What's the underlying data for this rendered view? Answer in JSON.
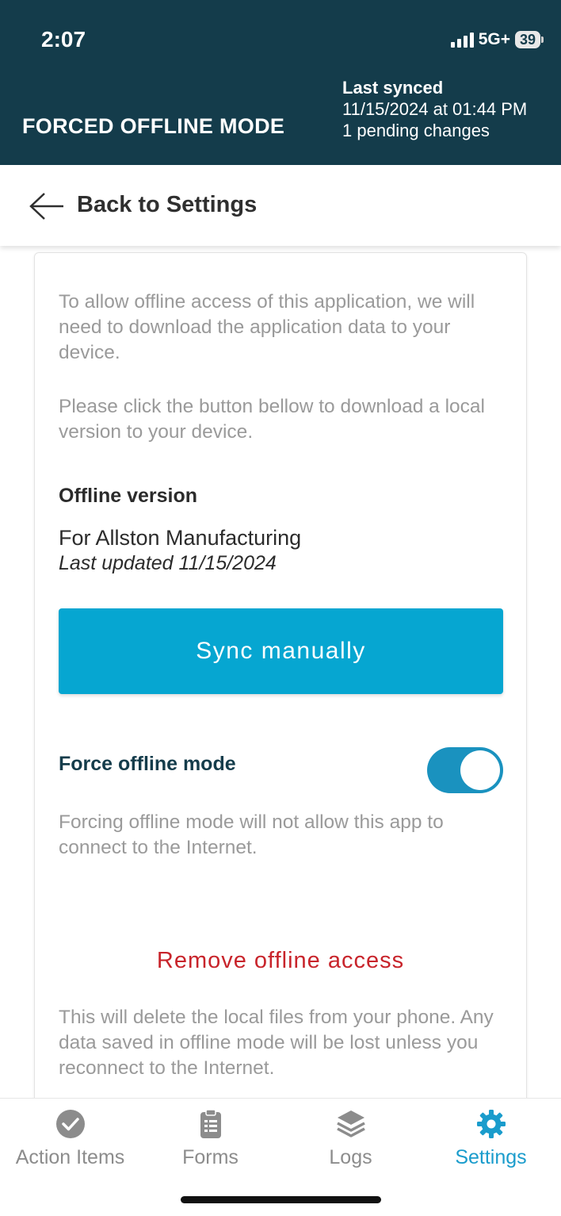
{
  "status_bar": {
    "time": "2:07",
    "network": "5G+",
    "battery": "39"
  },
  "header": {
    "title": "FORCED OFFLINE MODE",
    "last_synced_label": "Last synced",
    "last_synced_value": "11/15/2024 at 01:44 PM",
    "pending": "1 pending changes"
  },
  "back": {
    "label": "Back to Settings"
  },
  "content": {
    "intro1": "To allow offline access of this application, we will need to download the application data to your device.",
    "intro2": "Please click the button bellow to download a local version to your device.",
    "offline_title": "Offline version",
    "org_name": "For Allston Manufacturing",
    "last_updated": "Last updated 11/15/2024",
    "sync_button": "Sync manually",
    "force_label": "Force offline mode",
    "force_on": true,
    "force_desc": "Forcing offline mode will not allow this app to connect to the Internet.",
    "remove_label": "Remove offline access",
    "remove_desc": "This will delete the local files from your phone. Any data saved in offline mode will be lost unless you reconnect to the Internet."
  },
  "nav": {
    "items": [
      {
        "label": "Action Items",
        "icon": "check-circle-icon"
      },
      {
        "label": "Forms",
        "icon": "clipboard-icon"
      },
      {
        "label": "Logs",
        "icon": "layers-icon"
      },
      {
        "label": "Settings",
        "icon": "gear-icon",
        "active": true
      }
    ]
  },
  "colors": {
    "header_bg": "#143c4b",
    "accent": "#06a6d1",
    "toggle_on": "#1a92bf",
    "danger": "#c8242b",
    "nav_active": "#1a9ccc"
  }
}
